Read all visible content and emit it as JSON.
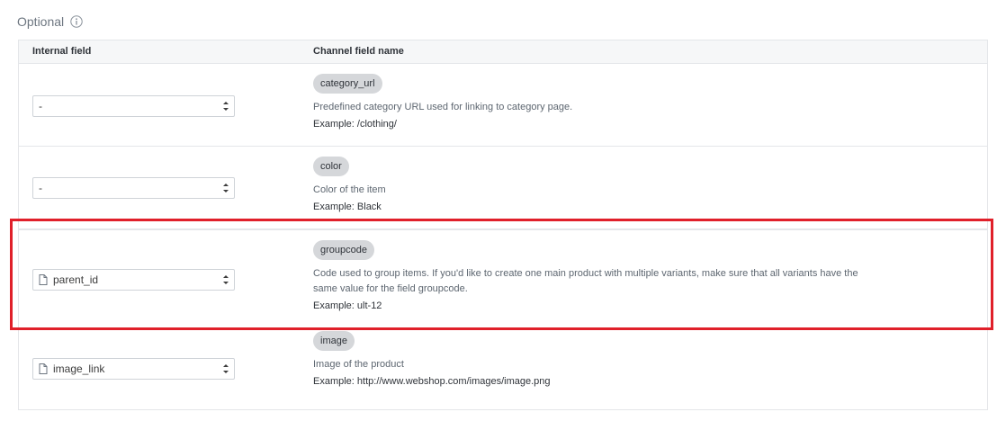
{
  "section": {
    "title": "Optional"
  },
  "table": {
    "header": {
      "internal_field": "Internal field",
      "channel_field_name": "Channel field name"
    },
    "rows": [
      {
        "selected": "-",
        "has_file_icon": false,
        "tag": "category_url",
        "description": "Predefined category URL used for linking to category page.",
        "example": "Example: /clothing/"
      },
      {
        "selected": "-",
        "has_file_icon": false,
        "tag": "color",
        "description": "Color of the item",
        "example": "Example: Black"
      },
      {
        "selected": "parent_id",
        "has_file_icon": true,
        "tag": "groupcode",
        "description": "Code used to group items. If you'd like to create one main product with multiple variants, make sure that all variants have the same value for the field groupcode.",
        "example": "Example: ult-12",
        "highlighted": true
      },
      {
        "selected": "image_link",
        "has_file_icon": true,
        "tag": "image",
        "description": "Image of the product",
        "example": "Example: http://www.webshop.com/images/image.png"
      }
    ]
  },
  "colors": {
    "highlight": "#e0202a",
    "tag_bg": "#d5d7da"
  }
}
